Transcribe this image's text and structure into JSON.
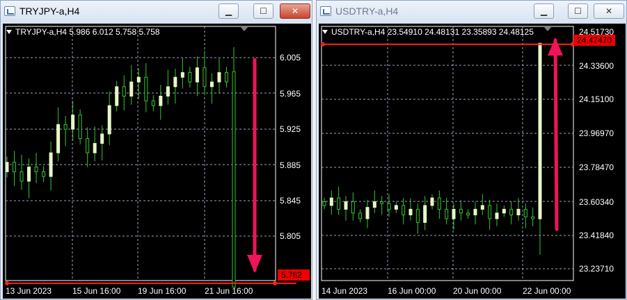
{
  "left_window": {
    "title": "TRYJPY-a,H4",
    "info": "TRYJPY-a,H4  5.986 6.012 5.758 5.758",
    "price_axis": [
      "6.005",
      "5.965",
      "5.925",
      "5.885",
      "5.845",
      "5.805"
    ],
    "current_price": "5.762",
    "time_axis": [
      "13 Jun 2023",
      "15 Jun 16:00",
      "19 Jun 16:00",
      "21 Jun 16:00"
    ],
    "buttons": {
      "minimize": "▁",
      "maximize": "☐",
      "close": "✕"
    }
  },
  "right_window": {
    "title": "USDTRY-a,H4",
    "info": "USDTRY-a,H4  23.54910 24.48131 23.35893 24.48125",
    "price_axis": [
      "24.51730",
      "24.33600",
      "24.15100",
      "23.96970",
      "23.78470",
      "23.60340",
      "23.41840",
      "23.23710"
    ],
    "current_price": "24.47470",
    "time_axis": [
      "14 Jun 2023",
      "16 Jun 00:00",
      "20 Jun 00:00",
      "22 Jun 00:00"
    ],
    "buttons": {
      "minimize": "▁",
      "maximize": "☐",
      "close": "✕"
    }
  },
  "colors": {
    "bull": "#e8f5c8",
    "bear": "#32c832",
    "grid": "#a0a0c8",
    "price_line": "#ff2020",
    "arrow": "#f0145a"
  },
  "chart_data": [
    {
      "type": "candlestick",
      "symbol": "TRYJPY-a",
      "timeframe": "H4",
      "ohlc_last": {
        "open": 5.986,
        "high": 6.012,
        "low": 5.758,
        "close": 5.758
      },
      "ylim": [
        5.77,
        6.025
      ],
      "closes": [
        5.89,
        5.88,
        5.87,
        5.885,
        5.88,
        5.875,
        5.9,
        5.93,
        5.925,
        5.94,
        5.915,
        5.9,
        5.91,
        5.92,
        5.95,
        5.97,
        5.96,
        5.975,
        5.98,
        5.955,
        5.95,
        5.96,
        5.97,
        5.98,
        5.985,
        5.975,
        5.99,
        5.97,
        5.975,
        5.985,
        5.975,
        5.758
      ],
      "annotation": "down arrow toward 5.762"
    },
    {
      "type": "candlestick",
      "symbol": "USDTRY-a",
      "timeframe": "H4",
      "ohlc_last": {
        "open": 23.5491,
        "high": 24.48131,
        "low": 23.35893,
        "close": 24.48125
      },
      "ylim": [
        23.2,
        24.54
      ],
      "closes": [
        23.62,
        23.66,
        23.6,
        23.64,
        23.58,
        23.55,
        23.61,
        23.64,
        23.63,
        23.6,
        23.62,
        23.57,
        23.6,
        23.53,
        23.62,
        23.66,
        23.6,
        23.55,
        23.6,
        23.58,
        23.57,
        23.6,
        23.62,
        23.55,
        23.58,
        23.6,
        23.57,
        23.6,
        23.56,
        23.55,
        24.48
      ],
      "annotation": "up arrow toward 24.47470"
    }
  ]
}
